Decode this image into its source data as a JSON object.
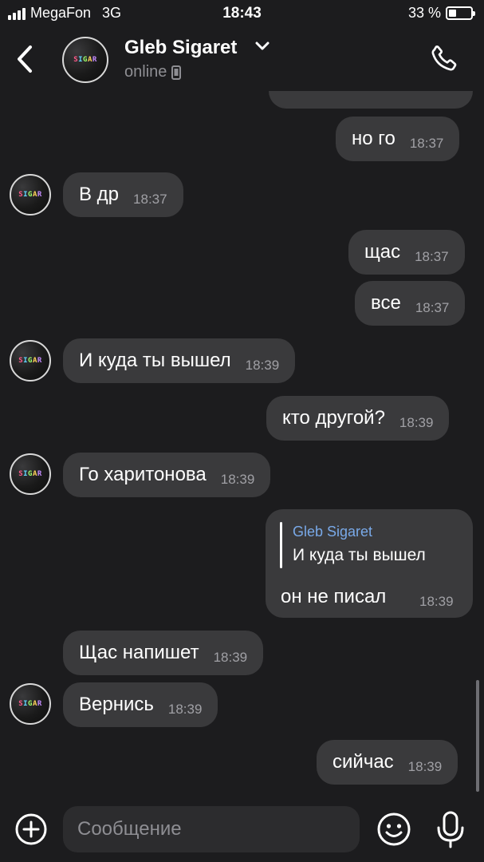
{
  "status_bar": {
    "carrier": "MegaFon",
    "network": "3G",
    "time": "18:43",
    "battery": "33 %",
    "battery_level": 0.33
  },
  "header": {
    "contact_name": "Gleb Sigaret",
    "status": "online",
    "avatar_logo": "SIGAR"
  },
  "messages": [
    {
      "side": "out",
      "text": "но го",
      "time": "18:37"
    },
    {
      "side": "in",
      "text": "В др",
      "time": "18:37"
    },
    {
      "side": "out",
      "text": "щас",
      "time": "18:37"
    },
    {
      "side": "out",
      "text": "все",
      "time": "18:37"
    },
    {
      "side": "in",
      "text": "И куда ты вышел",
      "time": "18:39"
    },
    {
      "side": "out",
      "text": "кто другой?",
      "time": "18:39"
    },
    {
      "side": "in",
      "text": "Го харитонова",
      "time": "18:39"
    },
    {
      "side": "out",
      "quote_author": "Gleb Sigaret",
      "quote_text": "И куда ты вышел",
      "text": "он не писал",
      "time": "18:39"
    },
    {
      "side": "in",
      "text": "Щас напишет",
      "time": "18:39"
    },
    {
      "side": "in",
      "text": "Вернись",
      "time": "18:39"
    },
    {
      "side": "out",
      "text": "сийчас",
      "time": "18:39"
    }
  ],
  "input": {
    "placeholder": "Сообщение"
  },
  "colors": {
    "background": "#1c1c1e",
    "bubble": "#3a3a3c",
    "quote_author": "#79a9e8",
    "muted": "#8e8e93"
  }
}
